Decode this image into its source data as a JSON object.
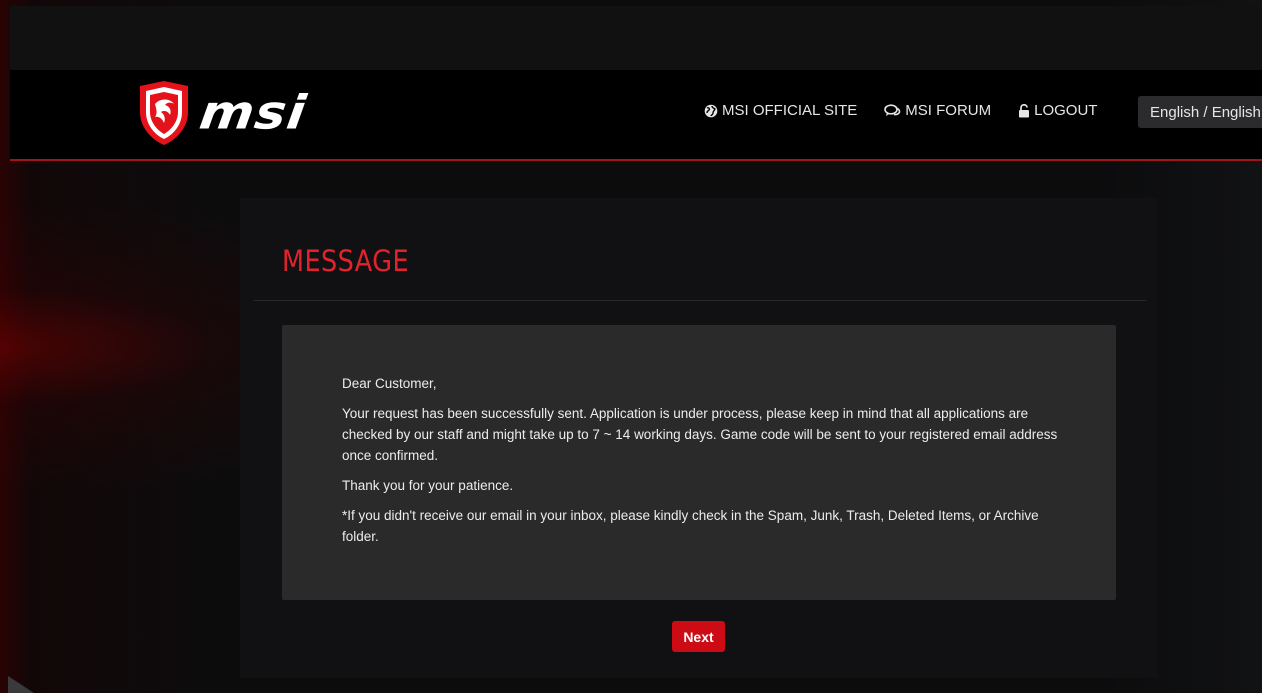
{
  "header": {
    "brand_text": "msi",
    "nav": [
      {
        "label": "MSI OFFICIAL SITE",
        "icon": "globe-icon"
      },
      {
        "label": "MSI FORUM",
        "icon": "chat-bubbles-icon"
      },
      {
        "label": "LOGOUT",
        "icon": "unlock-icon"
      }
    ],
    "language": "English / English"
  },
  "message": {
    "title": "MESSAGE",
    "greeting": "Dear Customer,",
    "body": "Your request has been successfully sent. Application is under process, please keep in mind that all applications are checked by our staff and might take up to 7 ~ 14 working days. Game code will be sent to your registered email address once confirmed.",
    "thanks": "Thank you for your patience.",
    "note": "*If you didn't receive our email in your inbox, please kindly check in the Spam, Junk, Trash, Deleted Items, or Archive folder."
  },
  "actions": {
    "next_label": "Next"
  },
  "colors": {
    "accent_red": "#cc0b14",
    "title_red": "#e2222d",
    "header_bg": "#000000",
    "panel_bg": "#111113",
    "box_bg": "#2a2a2b"
  }
}
